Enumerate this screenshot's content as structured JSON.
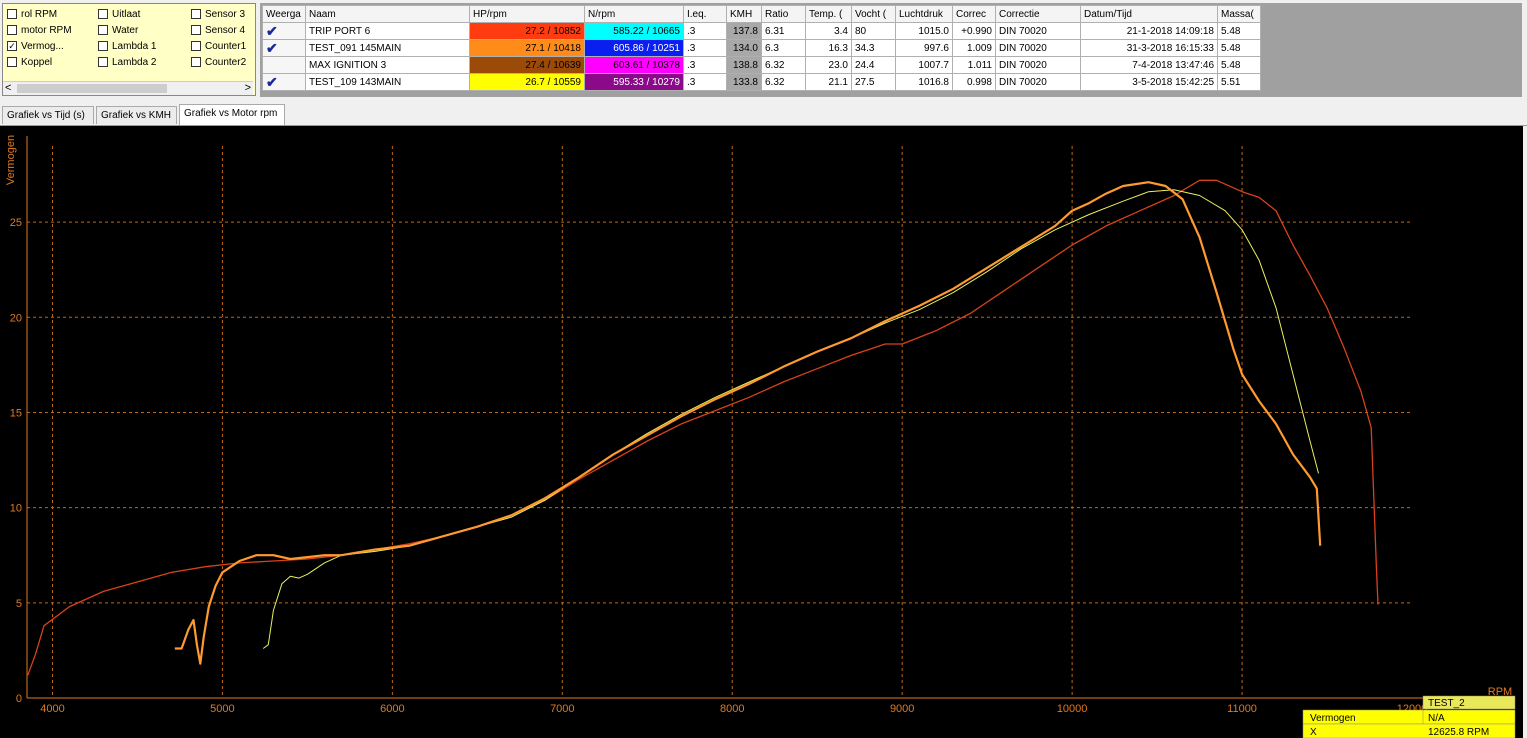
{
  "checkboxes": [
    {
      "label": "rol RPM",
      "checked": false
    },
    {
      "label": "motor RPM",
      "checked": false
    },
    {
      "label": "Vermog...",
      "checked": true
    },
    {
      "label": "Koppel",
      "checked": false
    },
    {
      "label": "Uitlaat",
      "checked": false
    },
    {
      "label": "Water",
      "checked": false
    },
    {
      "label": "Lambda 1",
      "checked": false
    },
    {
      "label": "Lambda 2",
      "checked": false
    },
    {
      "label": "Sensor 3",
      "checked": false
    },
    {
      "label": "Sensor 4",
      "checked": false
    },
    {
      "label": "Counter1",
      "checked": false
    },
    {
      "label": "Counter2",
      "checked": false
    }
  ],
  "scroll": {
    "left": "<",
    "right": ">"
  },
  "table": {
    "headers": [
      "Weerga",
      "Naam",
      "HP/rpm",
      "N/rpm",
      "I.eq.",
      "KMH",
      "Ratio",
      "Temp. (",
      "Vocht (",
      "Luchtdruk",
      "Correc",
      "Correctie",
      "Datum/Tijd",
      "Massa("
    ],
    "rows": [
      {
        "checked": true,
        "name": "TRIP PORT 6",
        "hp": "27.2 / 10852",
        "hp_color": "#ff3c10",
        "n": "585.22 / 10665",
        "n_color": "#00ffff",
        "ieq": ".3",
        "kmh": "137.8",
        "ratio": "6.31",
        "temp": "3.4",
        "vocht": "80",
        "lucht": "1015.0",
        "correc": "+0.990",
        "correctie": "DIN 70020",
        "datum": "21-1-2018 14:09:18",
        "massa": "5.48"
      },
      {
        "checked": true,
        "name": "TEST_091 145MAIN",
        "hp": "27.1 / 10418",
        "hp_color": "#ff8c1a",
        "n": "605.86 / 10251",
        "n_color": "#0a1ef0",
        "ieq": ".3",
        "kmh": "134.0",
        "ratio": "6.3",
        "temp": "16.3",
        "vocht": "34.3",
        "lucht": "997.6",
        "correc": "1.009",
        "correctie": "DIN 70020",
        "datum": "31-3-2018 16:15:33",
        "massa": "5.48"
      },
      {
        "checked": false,
        "name": "MAX IGNITION 3",
        "hp": "27.4 / 10639",
        "hp_color": "#9c4a08",
        "n": "603.61 / 10378",
        "n_color": "#ff00ff",
        "ieq": ".3",
        "kmh": "138.8",
        "ratio": "6.32",
        "temp": "23.0",
        "vocht": "24.4",
        "lucht": "1007.7",
        "correc": "1.011",
        "correctie": "DIN 70020",
        "datum": "7-4-2018 13:47:46",
        "massa": "5.48"
      },
      {
        "checked": true,
        "name": "TEST_109 143MAIN",
        "hp": "26.7 / 10559",
        "hp_color": "#ffff00",
        "n": "595.33 / 10279",
        "n_color": "#8a0a8a",
        "ieq": ".3",
        "kmh": "133.8",
        "ratio": "6.32",
        "temp": "21.1",
        "vocht": "27.5",
        "lucht": "1016.8",
        "correc": "0.998",
        "correctie": "DIN 70020",
        "datum": "3-5-2018 15:42:25",
        "massa": "5.51"
      }
    ]
  },
  "tabs": [
    "Grafiek vs Tijd (s)",
    "Grafiek vs KMH",
    "Grafiek vs Motor rpm"
  ],
  "active_tab": 2,
  "info": {
    "run_label": "TEST_2",
    "row1_label": "Vermogen",
    "row1_value": "N/A",
    "row2_label": "X",
    "row2_value": "12625.8 RPM"
  },
  "colors": {
    "grid": "#b86a18",
    "axis": "#e07a20",
    "run_trip": "#d8421a",
    "run_test091": "#ff9a30",
    "run_test109": "#e8f060"
  },
  "chart_data": {
    "type": "line",
    "ylabel": "Vermogen",
    "xlabel": "RPM",
    "xlim": [
      3850,
      12000
    ],
    "ylim": [
      0,
      29
    ],
    "xticks": [
      4000,
      5000,
      6000,
      7000,
      8000,
      9000,
      10000,
      11000,
      12000
    ],
    "yticks": [
      0,
      5,
      10,
      15,
      20,
      25
    ],
    "grid": true,
    "series": [
      {
        "name": "TRIP PORT 6",
        "color": "#d8421a",
        "width": 1.3,
        "points": [
          [
            3855,
            1.2
          ],
          [
            3900,
            2.3
          ],
          [
            3950,
            3.8
          ],
          [
            4100,
            4.8
          ],
          [
            4300,
            5.6
          ],
          [
            4500,
            6.1
          ],
          [
            4700,
            6.6
          ],
          [
            4900,
            6.9
          ],
          [
            5100,
            7.1
          ],
          [
            5300,
            7.2
          ],
          [
            5500,
            7.3
          ],
          [
            5700,
            7.5
          ],
          [
            5900,
            7.8
          ],
          [
            6100,
            8.1
          ],
          [
            6300,
            8.5
          ],
          [
            6500,
            9.0
          ],
          [
            6700,
            9.6
          ],
          [
            6900,
            10.4
          ],
          [
            7100,
            11.5
          ],
          [
            7300,
            12.5
          ],
          [
            7500,
            13.5
          ],
          [
            7700,
            14.4
          ],
          [
            7900,
            15.1
          ],
          [
            8100,
            15.8
          ],
          [
            8300,
            16.6
          ],
          [
            8500,
            17.3
          ],
          [
            8700,
            18.0
          ],
          [
            8900,
            18.6
          ],
          [
            9000,
            18.6
          ],
          [
            9200,
            19.3
          ],
          [
            9400,
            20.2
          ],
          [
            9600,
            21.4
          ],
          [
            9800,
            22.6
          ],
          [
            10000,
            23.8
          ],
          [
            10200,
            24.8
          ],
          [
            10400,
            25.6
          ],
          [
            10600,
            26.4
          ],
          [
            10750,
            27.2
          ],
          [
            10850,
            27.2
          ],
          [
            11000,
            26.6
          ],
          [
            11100,
            26.3
          ],
          [
            11200,
            25.6
          ],
          [
            11300,
            23.8
          ],
          [
            11400,
            22.2
          ],
          [
            11500,
            20.5
          ],
          [
            11600,
            18.4
          ],
          [
            11700,
            16.1
          ],
          [
            11760,
            14.2
          ],
          [
            11790,
            7.0
          ],
          [
            11800,
            4.9
          ]
        ]
      },
      {
        "name": "TEST_109 143MAIN",
        "color": "#e8f060",
        "width": 1.0,
        "points": [
          [
            5240,
            2.6
          ],
          [
            5270,
            2.8
          ],
          [
            5300,
            4.6
          ],
          [
            5350,
            6.0
          ],
          [
            5400,
            6.4
          ],
          [
            5450,
            6.3
          ],
          [
            5500,
            6.5
          ],
          [
            5600,
            7.1
          ],
          [
            5700,
            7.5
          ],
          [
            5900,
            7.7
          ],
          [
            6100,
            8.0
          ],
          [
            6300,
            8.5
          ],
          [
            6500,
            9.0
          ],
          [
            6700,
            9.5
          ],
          [
            6900,
            10.4
          ],
          [
            7100,
            11.6
          ],
          [
            7300,
            12.8
          ],
          [
            7500,
            13.9
          ],
          [
            7700,
            14.9
          ],
          [
            7900,
            15.8
          ],
          [
            8100,
            16.6
          ],
          [
            8300,
            17.4
          ],
          [
            8500,
            18.2
          ],
          [
            8700,
            18.9
          ],
          [
            8900,
            19.7
          ],
          [
            9100,
            20.4
          ],
          [
            9300,
            21.3
          ],
          [
            9500,
            22.4
          ],
          [
            9700,
            23.6
          ],
          [
            9900,
            24.6
          ],
          [
            10100,
            25.4
          ],
          [
            10300,
            26.1
          ],
          [
            10450,
            26.6
          ],
          [
            10600,
            26.7
          ],
          [
            10750,
            26.4
          ],
          [
            10900,
            25.6
          ],
          [
            11000,
            24.6
          ],
          [
            11100,
            23.0
          ],
          [
            11200,
            20.5
          ],
          [
            11300,
            17.0
          ],
          [
            11400,
            13.5
          ],
          [
            11450,
            11.8
          ]
        ]
      },
      {
        "name": "TEST_091 145MAIN",
        "color": "#ff9a30",
        "width": 2.2,
        "points": [
          [
            4720,
            2.6
          ],
          [
            4760,
            2.6
          ],
          [
            4800,
            3.6
          ],
          [
            4830,
            4.1
          ],
          [
            4850,
            2.8
          ],
          [
            4870,
            1.8
          ],
          [
            4890,
            3.2
          ],
          [
            4920,
            4.8
          ],
          [
            4960,
            5.9
          ],
          [
            5000,
            6.6
          ],
          [
            5100,
            7.2
          ],
          [
            5200,
            7.5
          ],
          [
            5300,
            7.5
          ],
          [
            5400,
            7.3
          ],
          [
            5500,
            7.4
          ],
          [
            5600,
            7.5
          ],
          [
            5700,
            7.5
          ],
          [
            5900,
            7.8
          ],
          [
            6100,
            8.0
          ],
          [
            6300,
            8.5
          ],
          [
            6500,
            9.0
          ],
          [
            6700,
            9.6
          ],
          [
            6900,
            10.5
          ],
          [
            7100,
            11.6
          ],
          [
            7300,
            12.8
          ],
          [
            7500,
            13.8
          ],
          [
            7700,
            14.8
          ],
          [
            7900,
            15.7
          ],
          [
            8100,
            16.5
          ],
          [
            8300,
            17.4
          ],
          [
            8500,
            18.2
          ],
          [
            8700,
            18.9
          ],
          [
            8900,
            19.8
          ],
          [
            9100,
            20.6
          ],
          [
            9300,
            21.5
          ],
          [
            9500,
            22.6
          ],
          [
            9700,
            23.7
          ],
          [
            9900,
            24.8
          ],
          [
            10000,
            25.6
          ],
          [
            10100,
            26.0
          ],
          [
            10200,
            26.5
          ],
          [
            10300,
            26.9
          ],
          [
            10450,
            27.1
          ],
          [
            10550,
            26.9
          ],
          [
            10650,
            26.2
          ],
          [
            10750,
            24.2
          ],
          [
            10850,
            21.3
          ],
          [
            10950,
            18.3
          ],
          [
            11000,
            17.0
          ],
          [
            11100,
            15.6
          ],
          [
            11200,
            14.4
          ],
          [
            11300,
            12.8
          ],
          [
            11400,
            11.6
          ],
          [
            11440,
            11.0
          ],
          [
            11460,
            8.0
          ]
        ]
      }
    ]
  }
}
